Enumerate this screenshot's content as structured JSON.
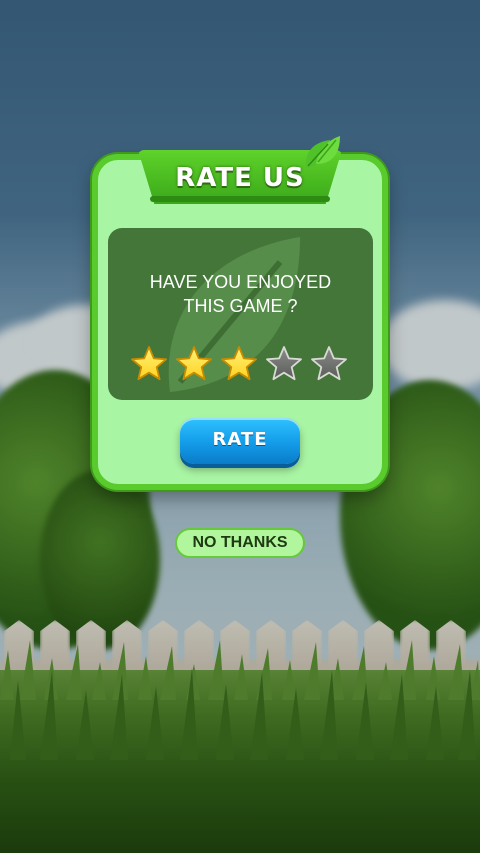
{
  "dialog": {
    "title": "RATE US",
    "question_line1": "HAVE YOU ENJOYED",
    "question_line2": "THIS GAME ?",
    "rating": 3,
    "max_rating": 5,
    "rate_label": "RATE",
    "no_thanks_label": "NO THANKS"
  },
  "colors": {
    "dialog_fill": "#a8f5a4",
    "dialog_border": "#5acb2d",
    "star_filled": "#ffd21f",
    "star_empty": "#5b5d5a",
    "rate_button": "#139be8"
  },
  "icons": [
    "leaf-icon",
    "star-icon",
    "leaf-watermark-icon"
  ]
}
